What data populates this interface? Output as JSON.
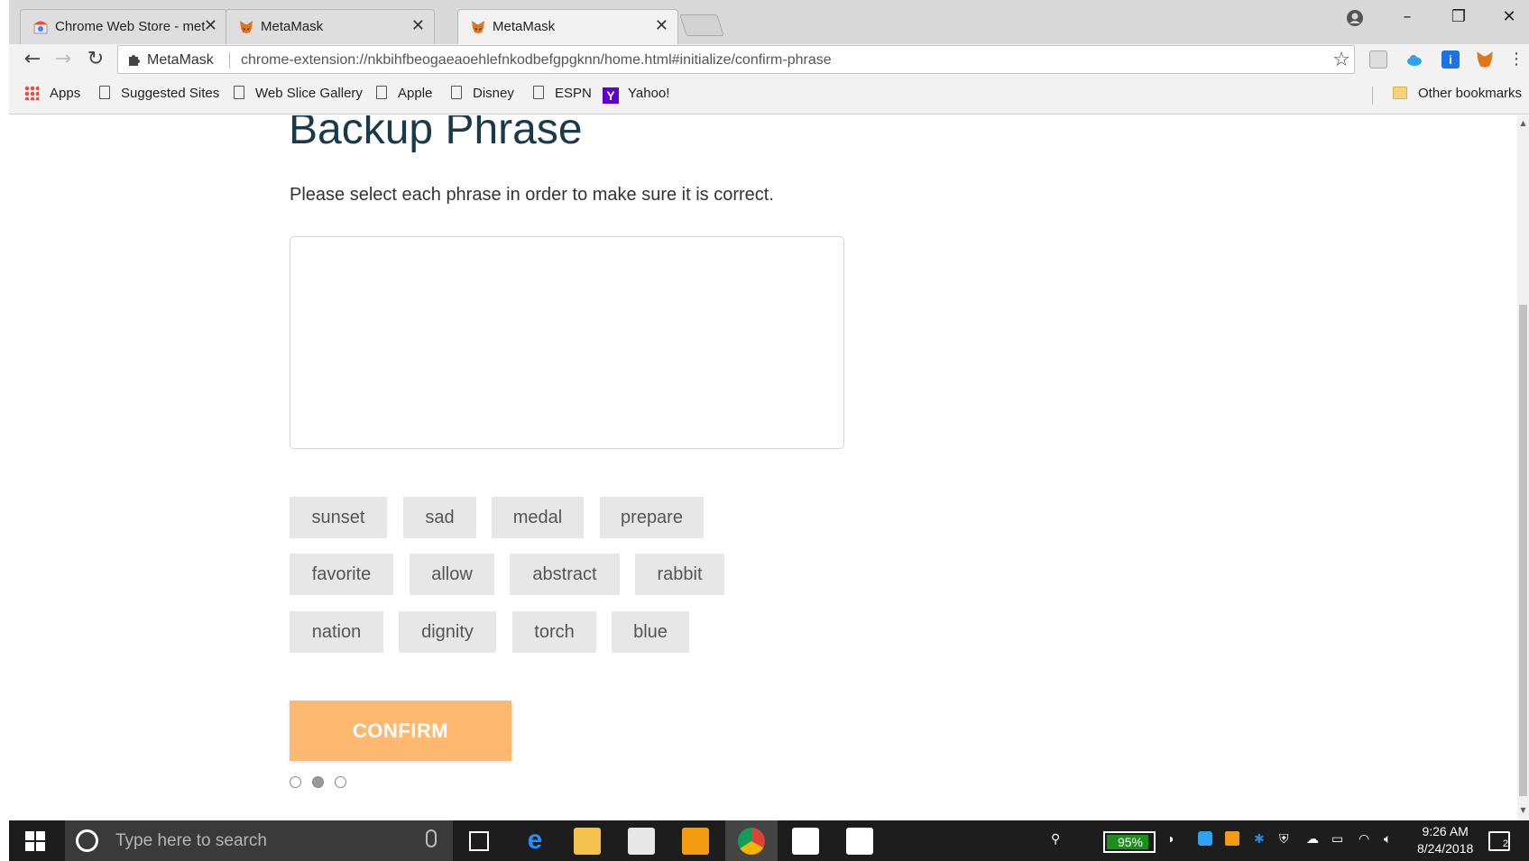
{
  "browser": {
    "tabs": [
      {
        "title": "Chrome Web Store - met",
        "icon": "chrome-web-store-icon"
      },
      {
        "title": "MetaMask",
        "icon": "metamask-fox-icon"
      },
      {
        "title": "MetaMask",
        "icon": "metamask-fox-icon"
      }
    ],
    "omnibox": {
      "site_label": "MetaMask",
      "url": "chrome-extension://nkbihfbeogaeaoehlefnkodbefgpgknn/home.html#initialize/confirm-phrase"
    },
    "bookmarks": [
      {
        "label": "Apps",
        "icon": "apps-grid-icon"
      },
      {
        "label": "Suggested Sites",
        "icon": "page-icon"
      },
      {
        "label": "Web Slice Gallery",
        "icon": "page-icon"
      },
      {
        "label": "Apple",
        "icon": "page-icon"
      },
      {
        "label": "Disney",
        "icon": "page-icon"
      },
      {
        "label": "ESPN",
        "icon": "page-icon"
      },
      {
        "label": "Yahoo!",
        "icon": "yahoo-icon"
      }
    ],
    "other_bookmarks": "Other bookmarks"
  },
  "page": {
    "heading": "Backup Phrase",
    "instructions": "Please select each phrase in order to make sure it is correct.",
    "words": [
      [
        "sunset",
        "sad",
        "medal",
        "prepare"
      ],
      [
        "favorite",
        "allow",
        "abstract",
        "rabbit"
      ],
      [
        "nation",
        "dignity",
        "torch",
        "blue"
      ]
    ],
    "confirm_label": "CONFIRM",
    "confirm_color": "#ffb870",
    "progress_steps": 3,
    "progress_active_step": 2
  },
  "taskbar": {
    "search_placeholder": "Type here to search",
    "battery": "95%",
    "time": "9:26 AM",
    "date": "8/24/2018",
    "notification_count": "2"
  }
}
